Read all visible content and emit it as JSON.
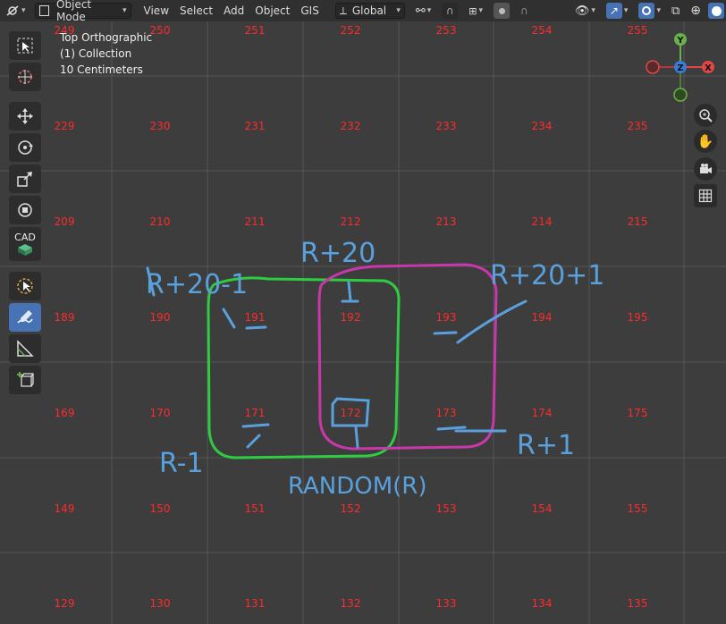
{
  "header": {
    "mode_label": "Object Mode",
    "menus": [
      "View",
      "Select",
      "Add",
      "Object",
      "GIS"
    ],
    "orientation_label": "Global"
  },
  "overlay": {
    "view_name": "Top Orthographic",
    "collection": "(1) Collection",
    "scale": "10 Centimeters"
  },
  "gizmo": {
    "x": "X",
    "y": "Y",
    "z": "Z"
  },
  "toolbar": {
    "cad_label": "CAD"
  },
  "grid": {
    "rows": [
      [
        "249",
        "250",
        "251",
        "252",
        "253",
        "254",
        "255"
      ],
      [
        "229",
        "230",
        "231",
        "232",
        "233",
        "234",
        "235"
      ],
      [
        "209",
        "210",
        "211",
        "212",
        "213",
        "214",
        "215"
      ],
      [
        "189",
        "190",
        "191",
        "192",
        "193",
        "194",
        "195"
      ],
      [
        "169",
        "170",
        "171",
        "172",
        "173",
        "174",
        "175"
      ],
      [
        "149",
        "150",
        "151",
        "152",
        "153",
        "154",
        "155"
      ],
      [
        "129",
        "130",
        "131",
        "132",
        "133",
        "134",
        "135"
      ]
    ]
  },
  "annotations": {
    "top_left": "R+20-1",
    "top_center": "R+20",
    "top_right": "R+20+1",
    "bottom_left": "R-1",
    "bottom_center": "RANDOM(R)",
    "bottom_right": "R+1"
  },
  "colors": {
    "viewport_bg": "#3d3d3d",
    "grid_line": "#555555",
    "cell_number": "#ff2a2a",
    "green_box": "#2ecc40",
    "magenta_box": "#c837ab",
    "ink_blue": "#5aa0dc",
    "active_blue": "#4772b3"
  }
}
